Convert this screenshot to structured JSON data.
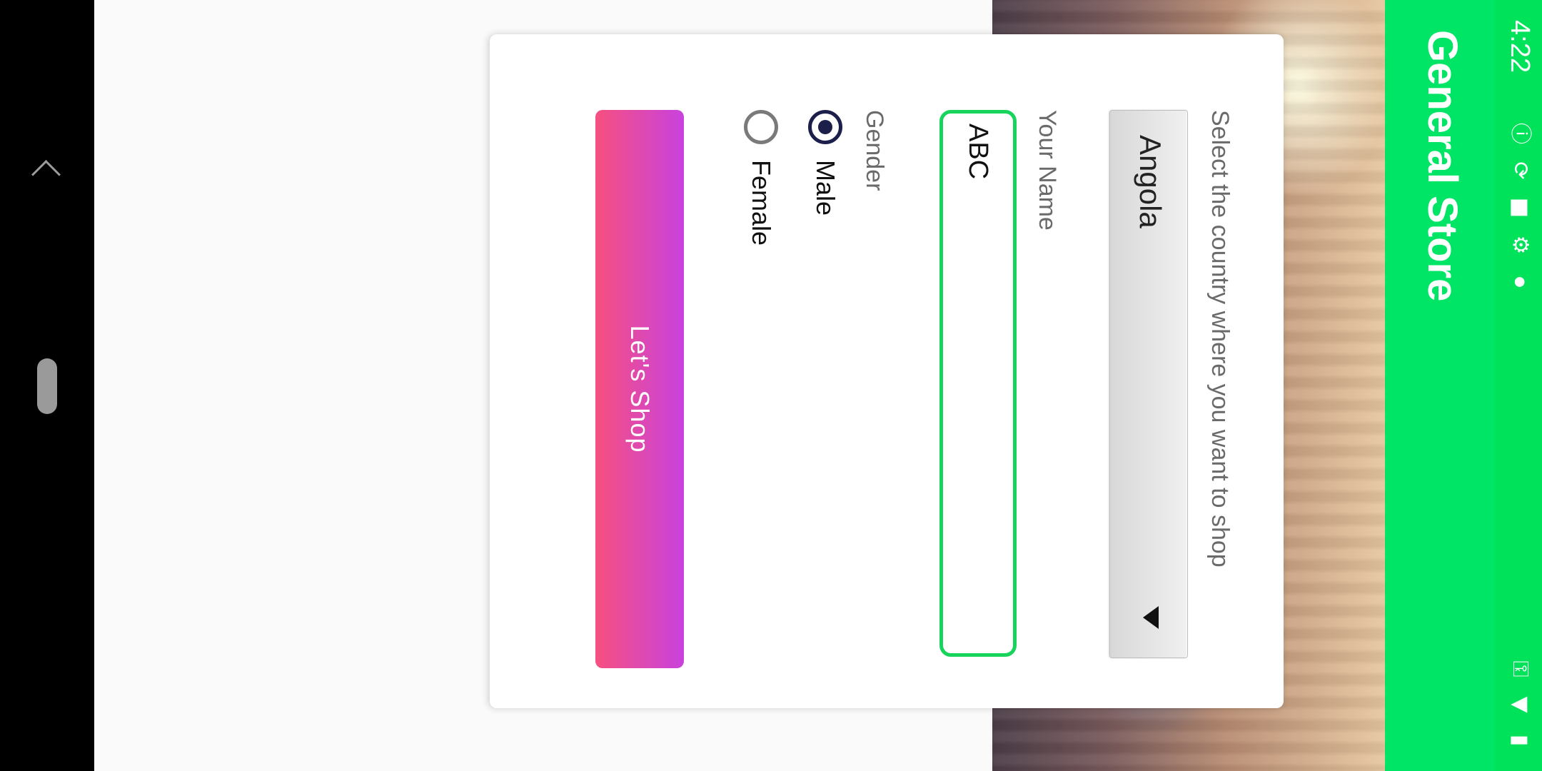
{
  "status_bar": {
    "time": "4:22",
    "icons_left": [
      "info-icon",
      "sync-icon",
      "stop-icon",
      "android-icon",
      "dot-icon"
    ],
    "icons_right": [
      "key-icon",
      "wifi-icon",
      "battery-charging-icon"
    ]
  },
  "toolbar": {
    "title": "General Store"
  },
  "form": {
    "country_label": "Select the country where you want to shop",
    "country_value": "Angola",
    "name_label": "Your Name",
    "name_value": "ABC",
    "gender_label": "Gender",
    "gender_options": [
      {
        "label": "Male",
        "checked": true
      },
      {
        "label": "Female",
        "checked": false
      }
    ],
    "submit_label": "Let's  Shop"
  },
  "colors": {
    "status_bar": "#00e25a",
    "toolbar": "#00e565",
    "input_border": "#18d45c",
    "button_gradient_start": "#f6507f",
    "button_gradient_end": "#c842de"
  }
}
